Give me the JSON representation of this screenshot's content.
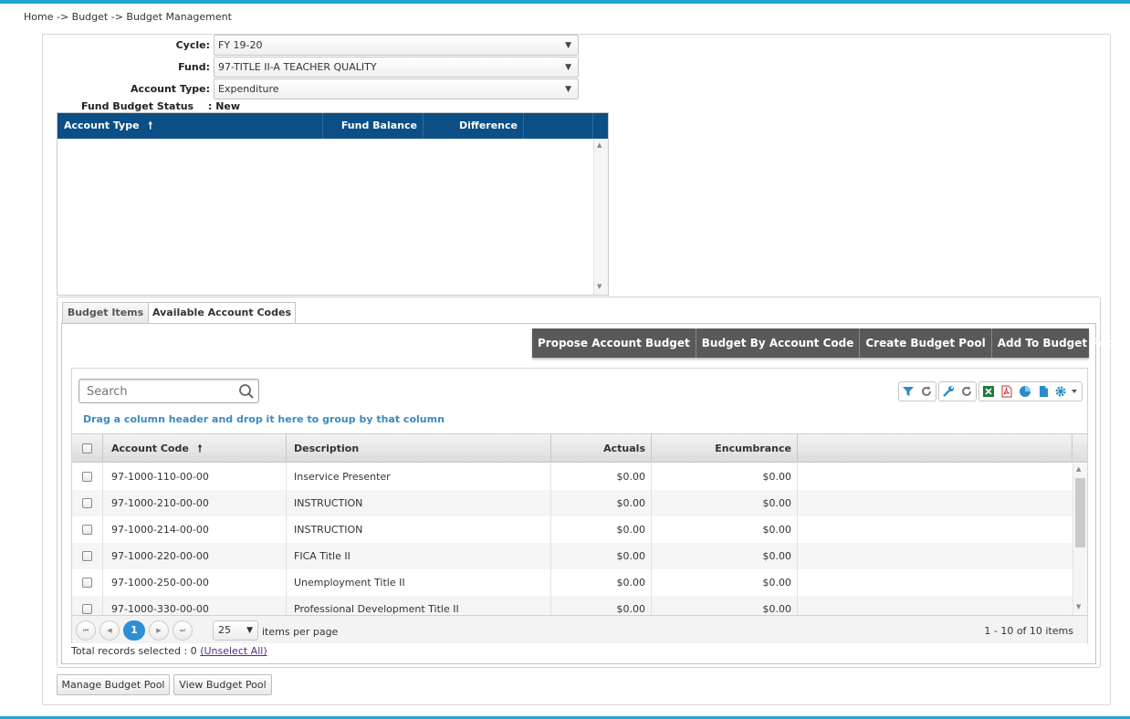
{
  "breadcrumb": "Home -> Budget -> Budget Management",
  "form": {
    "cycle_label": "Cycle:",
    "cycle_value": "FY 19-20",
    "fund_label": "Fund:",
    "fund_value": "97-TITLE II-A TEACHER QUALITY",
    "account_type_label": "Account Type:",
    "account_type_value": "Expenditure",
    "status_label": "Fund Budget Status",
    "status_value": ": New"
  },
  "summary_grid": {
    "columns": [
      "Account Type",
      "Fund Balance",
      "Difference"
    ],
    "sort_icon": "arrow-up-icon"
  },
  "tabs": [
    {
      "label": "Budget Items"
    },
    {
      "label": "Available Account Codes"
    }
  ],
  "actions": [
    {
      "label": "Propose Account Budget"
    },
    {
      "label": "Budget By Account Code"
    },
    {
      "label": "Create Budget Pool"
    },
    {
      "label": "Add To Budget Pool"
    }
  ],
  "codes_grid": {
    "search_placeholder": "Search",
    "group_hint": "Drag a column header and drop it here to group by that column",
    "columns": [
      "Account Code",
      "Description",
      "Actuals",
      "Encumbrance"
    ],
    "rows": [
      {
        "code": "97-1000-110-00-00",
        "description": "Inservice Presenter",
        "actuals": "$0.00",
        "encumbrance": "$0.00"
      },
      {
        "code": "97-1000-210-00-00",
        "description": "INSTRUCTION",
        "actuals": "$0.00",
        "encumbrance": "$0.00"
      },
      {
        "code": "97-1000-214-00-00",
        "description": "INSTRUCTION",
        "actuals": "$0.00",
        "encumbrance": "$0.00"
      },
      {
        "code": "97-1000-220-00-00",
        "description": "FICA Title II",
        "actuals": "$0.00",
        "encumbrance": "$0.00"
      },
      {
        "code": "97-1000-250-00-00",
        "description": "Unemployment Title II",
        "actuals": "$0.00",
        "encumbrance": "$0.00"
      },
      {
        "code": "97-1000-330-00-00",
        "description": "Professional Development Title II",
        "actuals": "$0.00",
        "encumbrance": "$0.00"
      }
    ],
    "pager": {
      "current_page": "1",
      "page_size": "25",
      "items_per_page_label": "items per page",
      "info": "1 - 10 of 10 items"
    },
    "total_selected_text": "Total records selected : 0",
    "unselect_all_label": "(Unselect All)"
  },
  "footer_buttons": {
    "manage_pool": "Manage Budget Pool",
    "view_pool": "View Budget Pool"
  },
  "colors": {
    "accent_bar": "#1fa6cf",
    "grid_header": "#0b4f86",
    "toolbar_bg": "#595959",
    "pager_current": "#2d8fd5",
    "group_hint": "#3b8bbf"
  }
}
